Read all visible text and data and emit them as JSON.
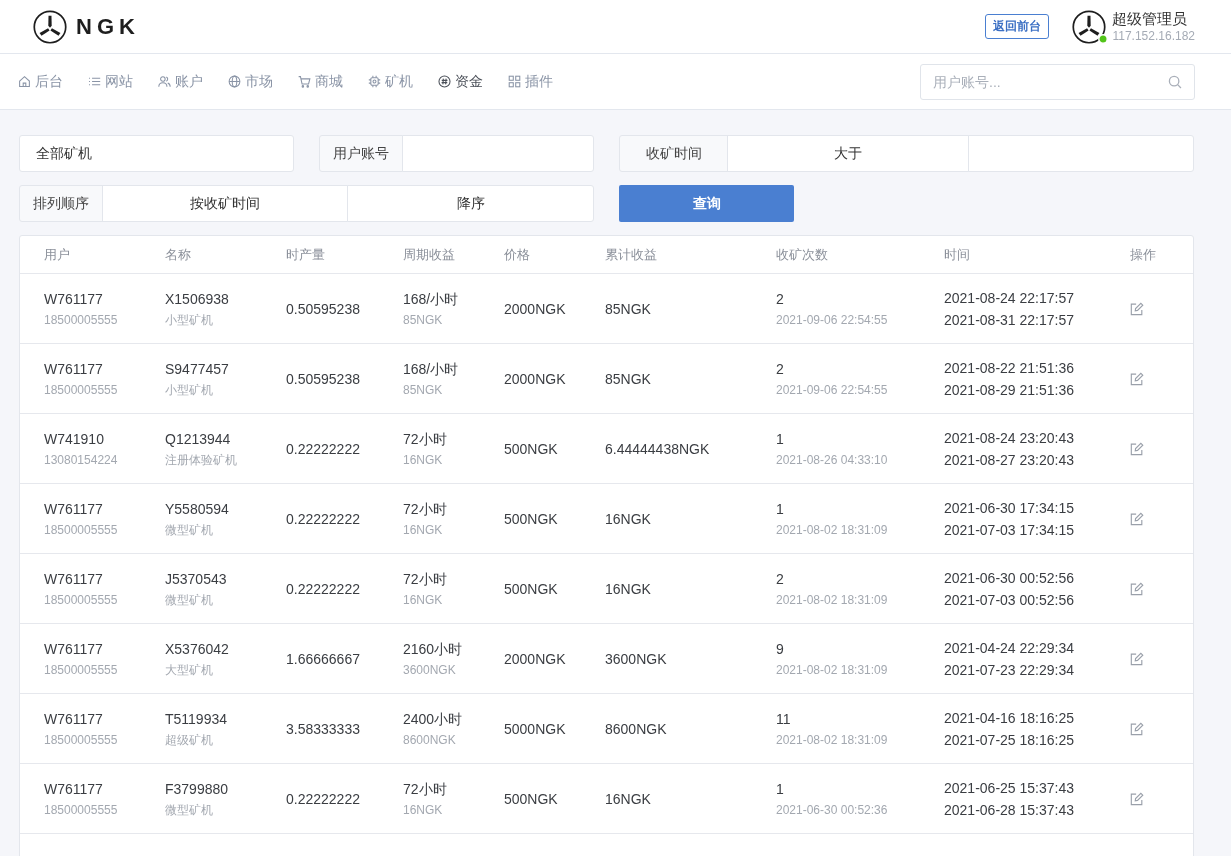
{
  "header": {
    "logo_text": "NGK",
    "back_button": "返回前台",
    "user": {
      "name": "超级管理员",
      "ip": "117.152.16.182",
      "online": true
    }
  },
  "nav": {
    "items": [
      {
        "label": "后台",
        "selected": false
      },
      {
        "label": "网站",
        "selected": false
      },
      {
        "label": "账户",
        "selected": false
      },
      {
        "label": "市场",
        "selected": false
      },
      {
        "label": "商城",
        "selected": false
      },
      {
        "label": "矿机",
        "selected": false
      },
      {
        "label": "资金",
        "selected": true
      },
      {
        "label": "插件",
        "selected": false
      }
    ],
    "search": {
      "placeholder": "用户账号..."
    }
  },
  "filters": {
    "miner_type": "全部矿机",
    "user_account": {
      "label": "用户账号"
    },
    "harvest_time": {
      "label": "收矿时间",
      "operator": "大于"
    },
    "sort": {
      "label": "排列顺序",
      "field": "按收矿时间",
      "direction": "降序"
    },
    "query_button": "查询"
  },
  "table": {
    "columns": [
      "用户",
      "名称",
      "时产量",
      "周期收益",
      "价格",
      "累计收益",
      "收矿次数",
      "时间",
      "操作"
    ],
    "rows": [
      {
        "user": "W761177",
        "phone": "18500005555",
        "miner": "X1506938",
        "miner_type": "小型矿机",
        "hourly_output": "0.50595238",
        "cycle": "168/小时",
        "cycle_income": "85NGK",
        "price": "2000NGK",
        "total_income": "85NGK",
        "harvest_count": "2",
        "last_harvest": "2021-09-06 22:54:55",
        "start_time": "2021-08-24 22:17:57",
        "end_time": "2021-08-31 22:17:57"
      },
      {
        "user": "W761177",
        "phone": "18500005555",
        "miner": "S9477457",
        "miner_type": "小型矿机",
        "hourly_output": "0.50595238",
        "cycle": "168/小时",
        "cycle_income": "85NGK",
        "price": "2000NGK",
        "total_income": "85NGK",
        "harvest_count": "2",
        "last_harvest": "2021-09-06 22:54:55",
        "start_time": "2021-08-22 21:51:36",
        "end_time": "2021-08-29 21:51:36"
      },
      {
        "user": "W741910",
        "phone": "13080154224",
        "miner": "Q1213944",
        "miner_type": "注册体验矿机",
        "hourly_output": "0.22222222",
        "cycle": "72小时",
        "cycle_income": "16NGK",
        "price": "500NGK",
        "total_income": "6.44444438NGK",
        "harvest_count": "1",
        "last_harvest": "2021-08-26 04:33:10",
        "start_time": "2021-08-24 23:20:43",
        "end_time": "2021-08-27 23:20:43"
      },
      {
        "user": "W761177",
        "phone": "18500005555",
        "miner": "Y5580594",
        "miner_type": "微型矿机",
        "hourly_output": "0.22222222",
        "cycle": "72小时",
        "cycle_income": "16NGK",
        "price": "500NGK",
        "total_income": "16NGK",
        "harvest_count": "1",
        "last_harvest": "2021-08-02 18:31:09",
        "start_time": "2021-06-30 17:34:15",
        "end_time": "2021-07-03 17:34:15"
      },
      {
        "user": "W761177",
        "phone": "18500005555",
        "miner": "J5370543",
        "miner_type": "微型矿机",
        "hourly_output": "0.22222222",
        "cycle": "72小时",
        "cycle_income": "16NGK",
        "price": "500NGK",
        "total_income": "16NGK",
        "harvest_count": "2",
        "last_harvest": "2021-08-02 18:31:09",
        "start_time": "2021-06-30 00:52:56",
        "end_time": "2021-07-03 00:52:56"
      },
      {
        "user": "W761177",
        "phone": "18500005555",
        "miner": "X5376042",
        "miner_type": "大型矿机",
        "hourly_output": "1.66666667",
        "cycle": "2160小时",
        "cycle_income": "3600NGK",
        "price": "2000NGK",
        "total_income": "3600NGK",
        "harvest_count": "9",
        "last_harvest": "2021-08-02 18:31:09",
        "start_time": "2021-04-24 22:29:34",
        "end_time": "2021-07-23 22:29:34"
      },
      {
        "user": "W761177",
        "phone": "18500005555",
        "miner": "T5119934",
        "miner_type": "超级矿机",
        "hourly_output": "3.58333333",
        "cycle": "2400小时",
        "cycle_income": "8600NGK",
        "price": "5000NGK",
        "total_income": "8600NGK",
        "harvest_count": "11",
        "last_harvest": "2021-08-02 18:31:09",
        "start_time": "2021-04-16 18:16:25",
        "end_time": "2021-07-25 18:16:25"
      },
      {
        "user": "W761177",
        "phone": "18500005555",
        "miner": "F3799880",
        "miner_type": "微型矿机",
        "hourly_output": "0.22222222",
        "cycle": "72小时",
        "cycle_income": "16NGK",
        "price": "500NGK",
        "total_income": "16NGK",
        "harvest_count": "1",
        "last_harvest": "2021-06-30 00:52:36",
        "start_time": "2021-06-25 15:37:43",
        "end_time": "2021-06-28 15:37:43"
      }
    ]
  }
}
